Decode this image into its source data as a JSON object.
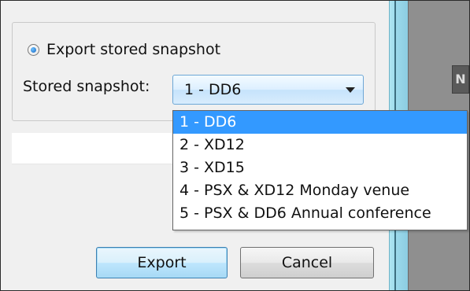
{
  "export_option": {
    "label": "Export stored snapshot",
    "selected": true
  },
  "stored_snapshot": {
    "label": "Stored snapshot:",
    "selected_value": "1 - DD6",
    "options": [
      "1 - DD6",
      "2 - XD12",
      "3 - XD15",
      "4 - PSX & XD12 Monday venue",
      "5 - PSX & DD6 Annual conference"
    ],
    "highlighted_index": 0
  },
  "buttons": {
    "export": "Export",
    "cancel": "Cancel"
  },
  "side_panel_glyph": "N",
  "colors": {
    "selection_highlight": "#3399ff",
    "dialog_background": "#f0f0f0",
    "radio_dot": "#1565c0",
    "default_button_border": "#3c7fb1"
  }
}
